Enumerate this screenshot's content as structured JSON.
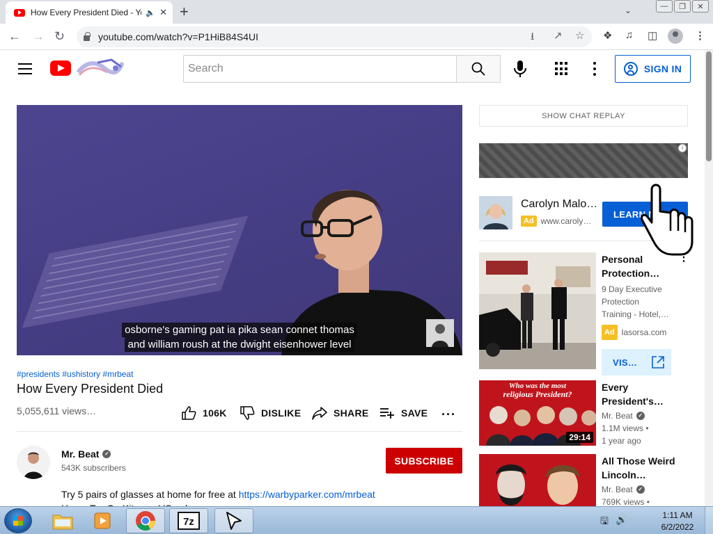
{
  "browser": {
    "tab_title": "How Every President Died - YouTube",
    "new_tab": "+",
    "url": "youtube.com/watch?v=P1HiB84S4UI"
  },
  "youtube": {
    "search_placeholder": "Search",
    "sign_in": "SIGN IN"
  },
  "video": {
    "caption_line1": "osborne's gaming pat ia pika sean connet thomas",
    "caption_line2": "and william roush at the dwight eisenhower level",
    "hashtags": "#presidents #ushistory #mrbeat",
    "title": "How Every President Died",
    "views": "5,055,611 views…",
    "likes": "106K",
    "dislike": "DISLIKE",
    "share": "SHARE",
    "save": "SAVE"
  },
  "channel": {
    "name": "Mr. Beat",
    "subscribers": "543K subscribers",
    "subscribe": "SUBSCRIBE",
    "description_text": "Try 5 pairs of glasses at home for free at ",
    "description_link": "https://warbyparker.com/mrbeat",
    "description_line2": "Home Try-On Kits are US only"
  },
  "sidebar": {
    "chat_replay": "SHOW CHAT REPLAY",
    "ad1": {
      "title": "Carolyn Malo…",
      "badge": "Ad",
      "url": "www.caroly…",
      "button": "LEARN MORE"
    },
    "ad2": {
      "title_line1": "Personal",
      "title_line2": "Protection…",
      "desc_line1": "9 Day Executive",
      "desc_line2": "Protection",
      "desc_line3": "Training - Hotel,…",
      "badge": "Ad",
      "url": "lasorsa.com",
      "button": "VIS…"
    },
    "videos": [
      {
        "title_line1": "Every",
        "title_line2": "President's…",
        "channel": "Mr. Beat",
        "views": "1.1M views •",
        "age": "1 year ago",
        "duration": "29:14",
        "thumb_text_line1": "Who was the most",
        "thumb_text_line2": "religious President?"
      },
      {
        "title_line1": "All Those Weird",
        "title_line2": "Lincoln…",
        "channel": "Mr. Beat",
        "views": "769K views •"
      }
    ]
  },
  "taskbar": {
    "time": "1:11 AM",
    "date": "6/2/2022"
  },
  "colors": {
    "youtube_red": "#ff0000",
    "link_blue": "#065fd4",
    "subscribe_red": "#cc0000",
    "ad_yellow": "#f6bf26"
  }
}
